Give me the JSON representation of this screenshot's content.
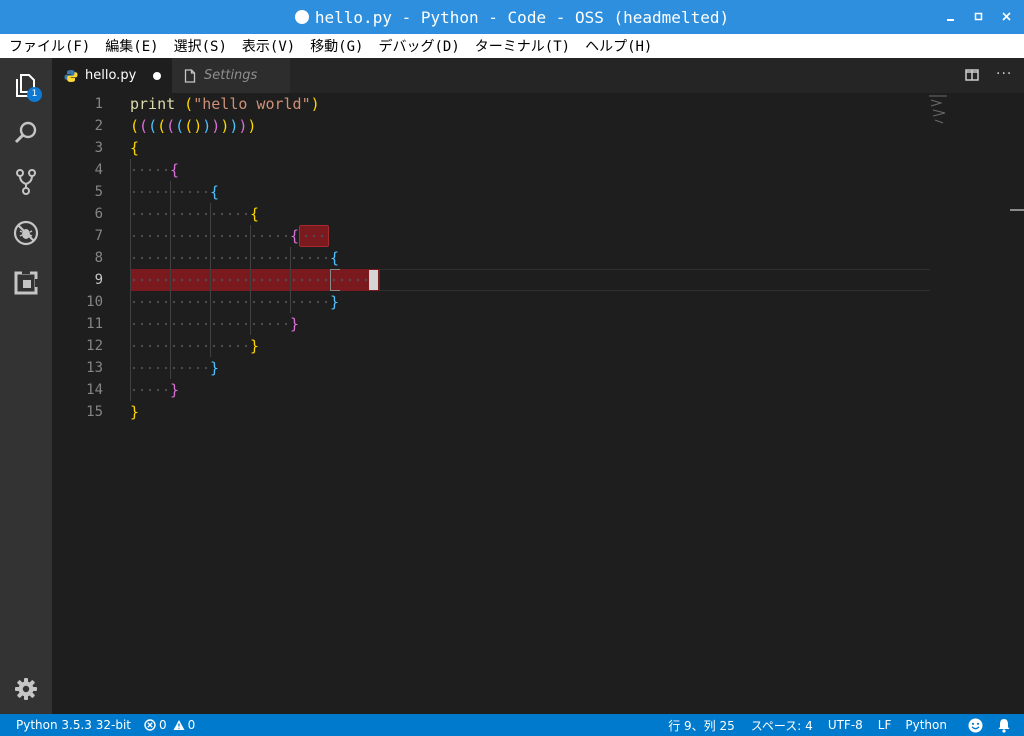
{
  "window": {
    "title": "hello.py - Python - Code - OSS (headmelted)",
    "controls": {
      "minimize": "▁",
      "maximize": "□",
      "close": "✕"
    }
  },
  "menu": [
    "ファイル(F)",
    "編集(E)",
    "選択(S)",
    "表示(V)",
    "移動(G)",
    "デバッグ(D)",
    "ターミナル(T)",
    "ヘルプ(H)"
  ],
  "activity": {
    "explorer_badge": "1",
    "icons": [
      "files-icon",
      "search-icon",
      "source-control-icon",
      "debug-icon",
      "extensions-icon",
      "gear-icon"
    ]
  },
  "tabs": [
    {
      "label": "hello.py",
      "icon": "python-icon",
      "dirty": true
    },
    {
      "label": "Settings",
      "icon": "file-icon",
      "dirty": false
    }
  ],
  "editor": {
    "line_numbers": [
      "1",
      "2",
      "3",
      "4",
      "5",
      "6",
      "7",
      "8",
      "9",
      "10",
      "11",
      "12",
      "13",
      "14",
      "15"
    ],
    "active_line": "9",
    "line1": {
      "keyword": "print",
      "paren_open": " (",
      "string": "\"hello world\"",
      "paren_close": ")"
    },
    "line2": [
      "(",
      "(",
      "(",
      "(",
      "(",
      "(",
      "(",
      ")",
      ")",
      ")",
      ")",
      ")",
      ")",
      ")"
    ],
    "brace_open": "{",
    "brace_close": "}"
  },
  "colors": {
    "accent": "#2d8fde",
    "status_bg": "#007acc",
    "bracket_gold": "#ffd700",
    "bracket_pink": "#da70d6",
    "bracket_blue": "#4fc1ff",
    "error_highlight": "#7a1a1f"
  },
  "status": {
    "interpreter": "Python 3.5.3 32-bit",
    "errors": "0",
    "warnings": "0",
    "position": "行 9、列 25",
    "spaces": "スペース: 4",
    "encoding": "UTF-8",
    "eol": "LF",
    "language": "Python"
  }
}
